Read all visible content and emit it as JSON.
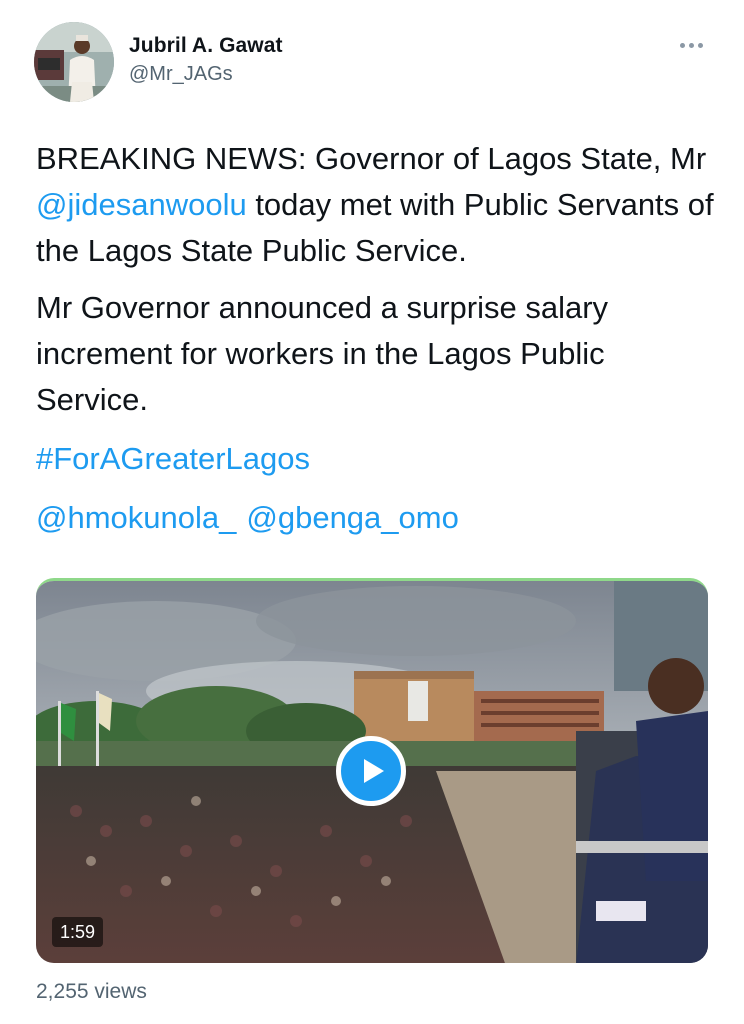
{
  "author": {
    "name": "Jubril A. Gawat",
    "handle": "@Mr_JAGs"
  },
  "tweet": {
    "p1_before": "BREAKING NEWS: Governor of Lagos State, Mr ",
    "p1_mention": "@jidesanwoolu",
    "p1_after": " today met with Public Servants of the Lagos State Public Service.",
    "p2": "Mr Governor announced a surprise salary increment for workers in the Lagos Public Service.",
    "hashtag": "#ForAGreaterLagos",
    "mentions": [
      "@hmokunola_",
      "@gbenga_omo"
    ]
  },
  "video": {
    "duration": "1:59"
  },
  "stats": {
    "views": "2,255 views"
  },
  "colors": {
    "link": "#1d9bf0",
    "secondary_text": "#536471"
  },
  "icons": {
    "more": "more-dots-icon",
    "play": "play-icon"
  }
}
